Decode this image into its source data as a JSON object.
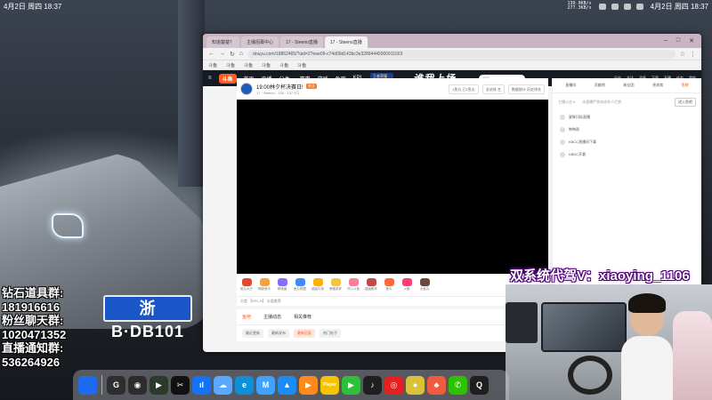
{
  "menubar": {
    "date_left": "4月2日 周四 18:37",
    "date_right": "4月2日 周四 18:37",
    "net_up": "130.0KB/s",
    "net_down": "277.3KB/s"
  },
  "browser": {
    "tabs": [
      {
        "label": "知道楚楚？",
        "active": false
      },
      {
        "label": "主播招募中心",
        "active": false
      },
      {
        "label": "17 - Steeno直播",
        "active": false
      },
      {
        "label": "17 - Steeno直播",
        "active": true
      }
    ],
    "url": "douyu.com/18862465/?uid=2?eae09-c74d09d143bc3e32894445000911603",
    "bookmarks": [
      "斗鱼",
      "斗鱼",
      "斗鱼",
      "斗鱼",
      "斗鱼",
      "斗鱼"
    ],
    "site_logo": "斗鱼",
    "nav": [
      "首页",
      "直播",
      "分类▾",
      "赛事",
      "游戏",
      "鱼吧",
      "KPL"
    ],
    "mini_banner_line1": "王者荣耀",
    "mini_banner_line2": "巅峰赛季中",
    "brand_banner": "谁我上场",
    "search_placeholder": "搜索",
    "nav_right": [
      "历史",
      "关注",
      "消息",
      "下载",
      "开播",
      "任务",
      "我的"
    ]
  },
  "room": {
    "title": "19:00林夕杯决赛日!",
    "badge": "关注",
    "meta": "17 · Steeno · 136 · 137.5万",
    "buttons": [
      "1鱼丸\n已1鱼丸",
      "全站排\n名",
      "数据统计\n历史排名"
    ]
  },
  "gifts": [
    {
      "label": "鱼丸大厅",
      "color": "#e24a2f"
    },
    {
      "label": "鸭脖音乐",
      "color": "#f2a33a"
    },
    {
      "label": "鸭嘴兽",
      "color": "#8b6cff"
    },
    {
      "label": "鱼丸联盟",
      "color": "#3e8bff"
    },
    {
      "label": "超级礼物",
      "color": "#ffb000"
    },
    {
      "label": "荣耀奖杯",
      "color": "#f7c442"
    },
    {
      "label": "开心斗鱼",
      "color": "#ff7b9a"
    },
    {
      "label": "超级跑车",
      "color": "#c04a4a"
    },
    {
      "label": "鱼丸",
      "color": "#ff6a3d"
    },
    {
      "label": "火箭",
      "color": "#ff3d6e"
    },
    {
      "label": "大鱼丸",
      "color": "#6c4a3a"
    }
  ],
  "under": {
    "left": "分类 【KPL-S】 分类推荐",
    "right": "鱼丸 23581  鱼翅 80010"
  },
  "comment_tabs": [
    {
      "label": "鱼吧",
      "on": true
    },
    {
      "label": "主播动态",
      "on": false
    },
    {
      "label": "相关推荐",
      "on": false
    }
  ],
  "filters": [
    {
      "label": "最近更新",
      "on": false
    },
    {
      "label": "最新发布",
      "on": false
    },
    {
      "label": "最新回复",
      "on": true
    },
    {
      "label": "热门帖子",
      "on": false
    }
  ],
  "side": {
    "tabs": [
      {
        "label": "直播间",
        "on": false
      },
      {
        "label": "贡献榜",
        "on": false
      },
      {
        "label": "粉丝团",
        "on": false
      },
      {
        "label": "贵宾席",
        "on": false
      },
      {
        "label": "鱼粮",
        "on": true
      }
    ],
    "sub_left": "主播公告 ▾",
    "sub_mid": "本直播严禁未成年人打赏",
    "sub_action": "进入鱼吧",
    "items": [
      "星辉闪烁直播",
      "鸭鸭帮",
      "KBCC直播间下载",
      "KBDC开赛"
    ]
  },
  "overlay": {
    "left_lines": [
      "钻石道具群:",
      "181916616",
      "粉丝聊天群:",
      "1020471352",
      "直播通知群:",
      "536264926"
    ],
    "right": "双系统代驾V：xiaoying_1106"
  },
  "plate": "浙B·DB101",
  "dock": [
    {
      "icon": "finder-icon",
      "label": "",
      "color": "#1d6cf0"
    },
    {
      "icon": "chrome-icon",
      "label": "G",
      "color": "#2e2e2e"
    },
    {
      "icon": "obs-icon",
      "label": "◉",
      "color": "#2c2c2c"
    },
    {
      "icon": "terminal-icon",
      "label": "▶",
      "color": "#2c3a2c"
    },
    {
      "icon": "capcut-icon",
      "label": "✂",
      "color": "#111111"
    },
    {
      "icon": "lark-icon",
      "label": "ıl",
      "color": "#1573f2"
    },
    {
      "icon": "cloud-icon",
      "label": "☁",
      "color": "#5ca8ff"
    },
    {
      "icon": "edge-icon",
      "label": "e",
      "color": "#0f8fd8"
    },
    {
      "icon": "meitu-icon",
      "label": "M",
      "color": "#3fa2ff"
    },
    {
      "icon": "lake-icon",
      "label": "▲",
      "color": "#1b8cf5"
    },
    {
      "icon": "tencent-video-icon",
      "label": "▶",
      "color": "#ff8a1c"
    },
    {
      "icon": "player-icon",
      "label": "Player",
      "color": "#f5c300"
    },
    {
      "icon": "iqiyi-icon",
      "label": "▶",
      "color": "#2fbf3a"
    },
    {
      "icon": "music-icon",
      "label": "♪",
      "color": "#1f1f1f"
    },
    {
      "icon": "netease-icon",
      "label": "◎",
      "color": "#e62020"
    },
    {
      "icon": "bean-icon",
      "label": "●",
      "color": "#d9c23a"
    },
    {
      "icon": "lizard-icon",
      "label": "♣",
      "color": "#f05a3e"
    },
    {
      "icon": "wechat-icon",
      "label": "✆",
      "color": "#2dc100"
    },
    {
      "icon": "qq-icon",
      "label": "Q",
      "color": "#1f1f1f"
    }
  ]
}
